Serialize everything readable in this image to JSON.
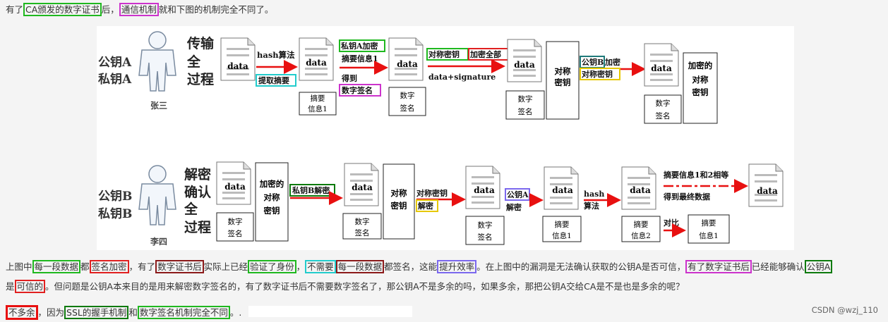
{
  "line1": {
    "a": "有了",
    "b": "CA颁发的数字证书",
    "c": "后，",
    "d": "通信机制",
    "e": "就和下图的机制完全不同了。"
  },
  "diagram": {
    "top": {
      "key1": "公钥A",
      "key2": "私钥A",
      "title": [
        "传输",
        "全",
        "过程"
      ],
      "person": "张三",
      "hash_label": "hash算法",
      "extract_label": "提取摘要",
      "data": "data",
      "digest_info": [
        "摘要",
        "信息1"
      ],
      "encrypt_a": "私钥A加密",
      "encrypt_b": "摘要信息1",
      "got": "得到",
      "signature_label": "数字签名",
      "sym_key": "对称密钥",
      "encrypt_all": "加密全部",
      "data_sig": "data+signature",
      "digital_sig": [
        "数字",
        "签名"
      ],
      "sym_key_box": [
        "对称",
        "密钥"
      ],
      "pubb_label": "公钥B",
      "pubb_encrypt": "加密",
      "encrypted_sym": "对称密钥",
      "encrypted_sym_box": [
        "加密的",
        "对称",
        "密钥"
      ]
    },
    "bottom": {
      "key1": "公钥B",
      "key2": "私钥B",
      "title": [
        "解密",
        "确认",
        "全",
        "过程"
      ],
      "person": "李四",
      "data": "data",
      "digital_sig": [
        "数字",
        "签名"
      ],
      "encrypted_sym_box": [
        "加密的",
        "对称",
        "密钥"
      ],
      "privb_decrypt": "私钥B解密",
      "sym_key_box": [
        "对称",
        "密钥"
      ],
      "sym_key": "对称密钥",
      "decrypt": "解密",
      "puba": "公钥A",
      "puba_decrypt": "解密",
      "digest_info1": [
        "摘要",
        "信息1"
      ],
      "hash_label": "hash",
      "hash_label2": "算法",
      "digest_info2": [
        "摘要",
        "信息2"
      ],
      "compare_text1": "摘要信息1和2相等",
      "compare_text2": "得到最终数据",
      "compare": "对比",
      "digest_result": [
        "摘要",
        "信息1"
      ]
    }
  },
  "para2": {
    "l1": [
      {
        "t": "上图中",
        "b": ""
      },
      {
        "t": "每一段数据",
        "b": "green"
      },
      {
        "t": "都",
        "b": ""
      },
      {
        "t": "签名加密",
        "b": "red"
      },
      {
        "t": "，有了",
        "b": ""
      },
      {
        "t": "数字证书后",
        "b": "darkred"
      },
      {
        "t": "实际上已经",
        "b": ""
      },
      {
        "t": "验证了身份",
        "b": "green"
      },
      {
        "t": "，",
        "b": ""
      },
      {
        "t": "不需要",
        "b": "cyan"
      },
      {
        "t": "每一段数据",
        "b": "darkred"
      },
      {
        "t": "都签名，这能",
        "b": ""
      },
      {
        "t": "提升效率",
        "b": "purple"
      },
      {
        "t": "。在上图中的漏洞是无法确认获取的公钥A是否可信，",
        "b": ""
      },
      {
        "t": "有了数字证书后",
        "b": "magenta"
      },
      {
        "t": "已经能够确认",
        "b": ""
      },
      {
        "t": "公钥A",
        "b": "darkgreen"
      }
    ],
    "l2": [
      {
        "t": "是",
        "b": ""
      },
      {
        "t": "可信的",
        "b": "red"
      },
      {
        "t": "。但问题是公钥A本来目的是用来解密数字签名的，有了数字证书后不需要数字签名了，那公钥A不是多余的吗，如果多余，那把公钥A交给CA是不是也是多余的呢？",
        "b": ""
      }
    ]
  },
  "para3": [
    {
      "t": "不多余",
      "b": "thickred"
    },
    {
      "t": "，因为",
      "b": ""
    },
    {
      "t": "SSL的握手机制",
      "b": "darkgreen"
    },
    {
      "t": "和",
      "b": ""
    },
    {
      "t": "数字签名机制完全不同",
      "b": "green"
    },
    {
      "t": "。",
      "b": ""
    },
    {
      "t": ".",
      "b": ""
    }
  ],
  "watermark": "CSDN @wzj_110"
}
